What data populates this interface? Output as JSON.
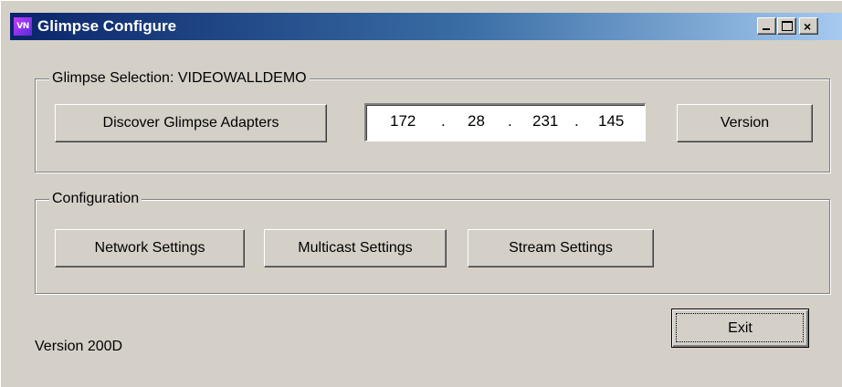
{
  "window": {
    "title": "Glimpse Configure",
    "icon_text": "VN",
    "controls": {
      "minimize": "_",
      "maximize": "□",
      "close": "×"
    }
  },
  "selection_group": {
    "label": "Glimpse Selection: VIDEOWALLDEMO",
    "discover_button": "Discover Glimpse Adapters",
    "ip_address": {
      "octet1": "172",
      "octet2": "28",
      "octet3": "231",
      "octet4": "145",
      "separator": "."
    },
    "version_button": "Version"
  },
  "configuration_group": {
    "label": "Configuration",
    "network_button": "Network Settings",
    "multicast_button": "Multicast Settings",
    "stream_button": "Stream Settings"
  },
  "footer": {
    "version_text": "Version 200D",
    "exit_button": "Exit"
  }
}
